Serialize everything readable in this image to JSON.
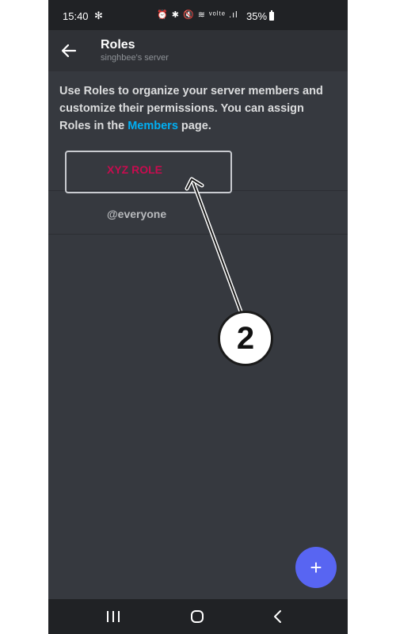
{
  "status_bar": {
    "time": "15:40",
    "fan_glyph": "✻",
    "sys_icons": "⏰ ✱ 🔇 ≋ ᵛᵒˡᵗᵉ .ıl",
    "battery_text": "35%"
  },
  "header": {
    "title": "Roles",
    "subtitle": "singhbee's server"
  },
  "description": {
    "text_before": "Use Roles to organize your server members and customize their permissions. You can assign Roles in the ",
    "link": "Members",
    "text_after": " page."
  },
  "roles": [
    {
      "name": "XYZ ROLE",
      "color": "#c70c4f"
    },
    {
      "name": "@everyone",
      "color": "#b9bbbe"
    }
  ],
  "fab": {
    "label": "+"
  },
  "annotation": {
    "step_number": "2"
  },
  "colors": {
    "background": "#36393f",
    "appbar": "#2f3136",
    "accent": "#5865f2",
    "link": "#00aff4"
  },
  "icons": {
    "back": "arrow-left-icon",
    "add": "plus-icon",
    "nav_recent": "recent-apps-icon",
    "nav_home": "home-icon",
    "nav_back": "chevron-left-icon"
  }
}
